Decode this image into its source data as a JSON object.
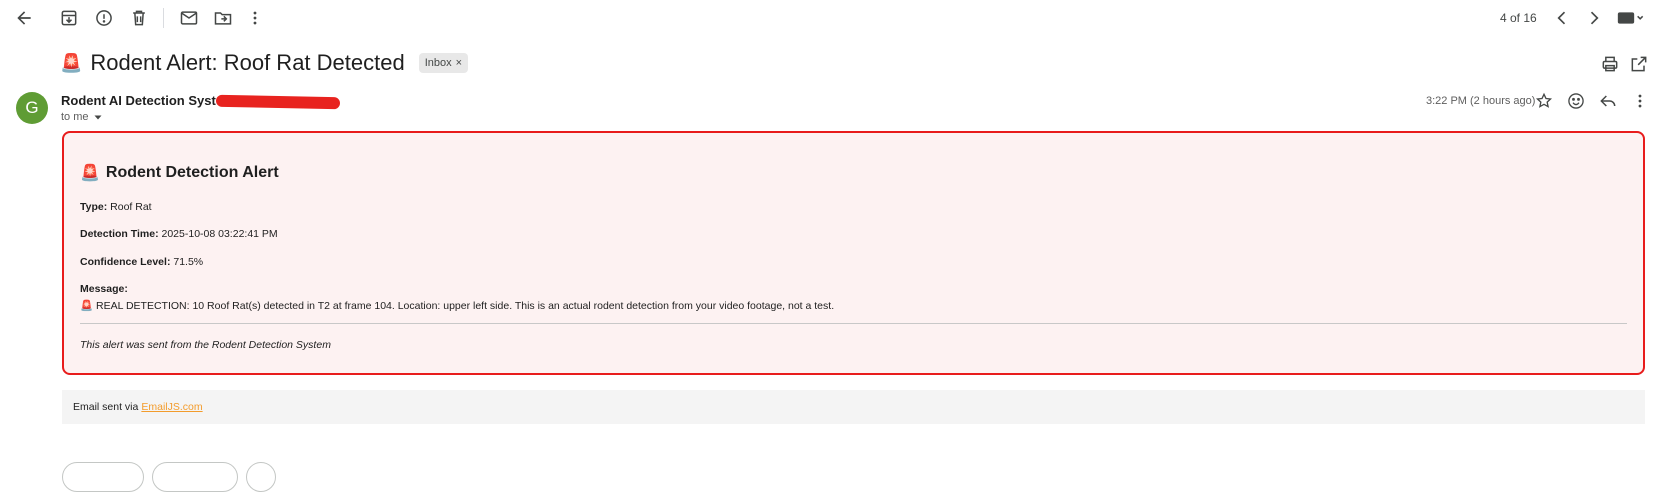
{
  "toolbar": {
    "icons": [
      "back-arrow-icon",
      "archive-icon",
      "report-spam-icon",
      "delete-icon",
      "mark-unread-icon",
      "move-to-icon",
      "more-vert-icon"
    ],
    "pagination": "4 of 16",
    "input_tools_icon": "keyboard-icon"
  },
  "subject": {
    "emoji": "🚨",
    "text": "Rodent Alert: Roof Rat Detected",
    "label": "Inbox",
    "label_close": "×"
  },
  "message": {
    "avatar_letter": "G",
    "avatar_color": "#5f9c34",
    "sender_name": "Rodent AI Detection System",
    "recipient": "to me",
    "time": "3:22 PM (2 hours ago)"
  },
  "alert": {
    "accent_color": "#e81c1c",
    "title_emoji": "🚨",
    "title": "Rodent Detection Alert",
    "type_label": "Type:",
    "type_value": "Roof Rat",
    "time_label": "Detection Time:",
    "time_value": "2025-10-08 03:22:41 PM",
    "confidence_label": "Confidence Level:",
    "confidence_value": "71.5%",
    "message_label": "Message:",
    "message_emoji": "🚨",
    "message_text": "REAL DETECTION: 10 Roof Rat(s) detected in T2 at frame 104. Location: upper left side. This is an actual rodent detection from your video footage, not a test.",
    "footer": "This alert was sent from the Rodent Detection System"
  },
  "via": {
    "prefix": "Email sent via",
    "link": "EmailJS.com",
    "link_color": "#f39c2c"
  }
}
